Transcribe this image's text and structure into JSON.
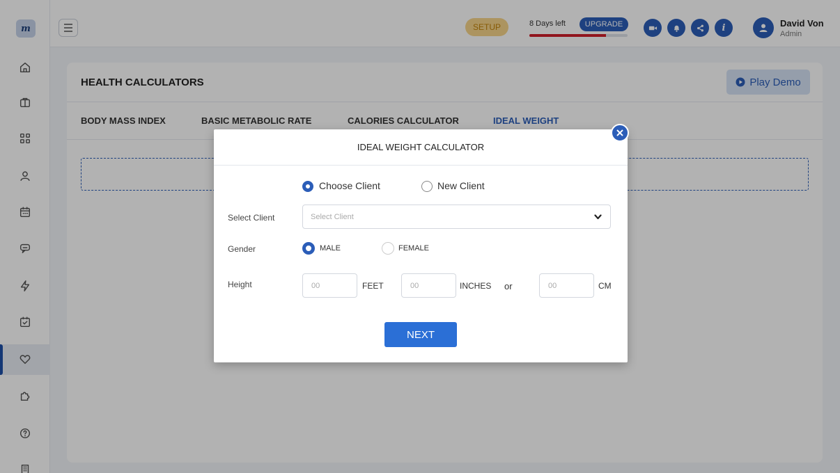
{
  "app": {
    "logo_text": "m"
  },
  "header": {
    "setup_label": "SETUP",
    "days_left": "8 Days left",
    "upgrade_label": "UPGRADE",
    "trial_progress": 0.78,
    "user_name": "David Von",
    "user_role": "Admin",
    "icons": [
      "video-icon",
      "bell-icon",
      "share-icon",
      "info-icon"
    ]
  },
  "sidebar": {
    "items": [
      {
        "name": "home-icon"
      },
      {
        "name": "briefcase-icon"
      },
      {
        "name": "apps-grid-icon"
      },
      {
        "name": "user-icon"
      },
      {
        "name": "calendar-icon"
      },
      {
        "name": "chat-icon"
      },
      {
        "name": "lightning-icon"
      },
      {
        "name": "calendar-check-icon"
      },
      {
        "name": "heart-icon",
        "active": true
      },
      {
        "name": "puzzle-icon"
      },
      {
        "name": "help-icon"
      },
      {
        "name": "building-icon"
      }
    ]
  },
  "page": {
    "title": "HEALTH CALCULATORS",
    "play_demo_label": "Play Demo",
    "tabs": [
      {
        "label": "BODY MASS INDEX"
      },
      {
        "label": "BASIC METABOLIC RATE"
      },
      {
        "label": "CALORIES CALCULATOR"
      },
      {
        "label": "IDEAL WEIGHT",
        "active": true
      }
    ]
  },
  "modal": {
    "title": "IDEAL WEIGHT  CALCULATOR",
    "client_options": [
      {
        "label": "Choose Client",
        "selected": true
      },
      {
        "label": "New Client",
        "selected": false
      }
    ],
    "select_client_label": "Select Client",
    "select_client_placeholder": "Select Client",
    "gender_label": "Gender",
    "gender_options": [
      {
        "label": "MALE",
        "selected": true
      },
      {
        "label": "FEMALE",
        "selected": false
      }
    ],
    "height_label": "Height",
    "feet_placeholder": "00",
    "feet_unit": "FEET",
    "inches_placeholder": "00",
    "inches_unit": "INCHES",
    "or_label": "or",
    "cm_placeholder": "00",
    "cm_unit": "CM",
    "next_label": "NEXT"
  },
  "colors": {
    "primary": "#2b5db8",
    "setup_bg": "#f6d58a",
    "setup_text": "#c2830c",
    "trial_bar": "#d01f2a"
  }
}
